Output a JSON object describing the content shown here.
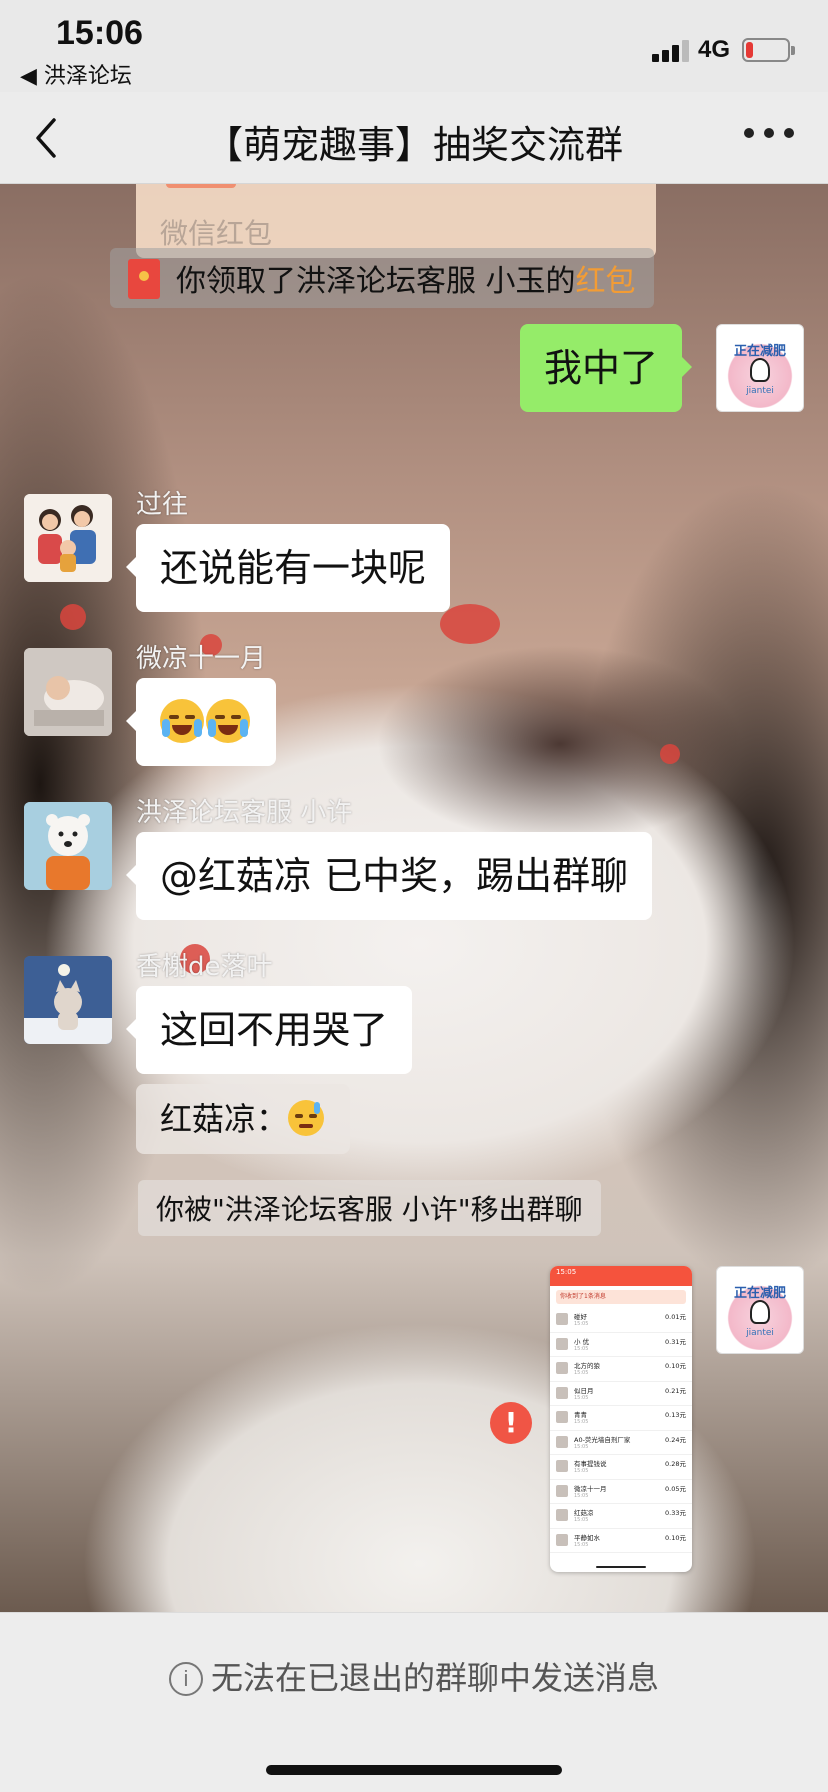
{
  "status_bar": {
    "time": "15:06",
    "back_app": "◀ 洪泽论坛",
    "network": "4G",
    "battery_level": 0.18,
    "battery_color": "#e53935"
  },
  "nav": {
    "title": "【萌宠趣事】抽奖交流群",
    "back_icon": "chevron-left-icon",
    "more_icon": "more-dots-icon"
  },
  "messages": {
    "redpacket_card_label": "微信红包",
    "claimed_notice_prefix": "你领取了洪泽论坛客服 小玉的",
    "claimed_notice_link": "红包",
    "self_text": "我中了",
    "self_avatar_text_top": "正在减肥",
    "self_avatar_text_bottom": "jiantei",
    "m1_sender": "过往",
    "m1_text": "还说能有一块呢",
    "m2_sender": "微凉十一月",
    "m3_sender": "洪泽论坛客服 小许",
    "m3_text": "@红菇凉 已中奖，踢出群聊",
    "m4_sender": "香榭de落叶",
    "m4_text": "这回不用哭了",
    "quoted_text": "红菇凉：",
    "removed_notice": "你被\"洪泽论坛客服 小许\"移出群聊",
    "fail_mark": "!"
  },
  "thumbnail": {
    "time": "15:05",
    "banner": "你收到了1条消息",
    "rows": [
      {
        "name": "碰好",
        "time": "15:05",
        "value": "0.01元"
      },
      {
        "name": "小 优",
        "time": "15:05",
        "value": "0.31元"
      },
      {
        "name": "北方的狼",
        "time": "15:05",
        "value": "0.10元"
      },
      {
        "name": "似日月",
        "time": "15:05",
        "value": "0.21元"
      },
      {
        "name": "青青",
        "time": "15:05",
        "value": "0.13元"
      },
      {
        "name": "A0-荧光墙自剂厂家",
        "time": "15:05",
        "value": "0.24元"
      },
      {
        "name": "有事提钱说",
        "time": "15:05",
        "value": "0.28元"
      },
      {
        "name": "微凉十一月",
        "time": "15:05",
        "value": "0.05元"
      },
      {
        "name": "红菇凉",
        "time": "15:05",
        "value": "0.33元"
      },
      {
        "name": "平静如水",
        "time": "15:05",
        "value": "0.10元"
      }
    ]
  },
  "bottom": {
    "notice": "无法在已退出的群聊中发送消息",
    "info_icon": "i"
  },
  "colors": {
    "wechat_green": "#95ec69",
    "link_orange": "#f39c34",
    "redpacket_red": "#e8473e"
  }
}
